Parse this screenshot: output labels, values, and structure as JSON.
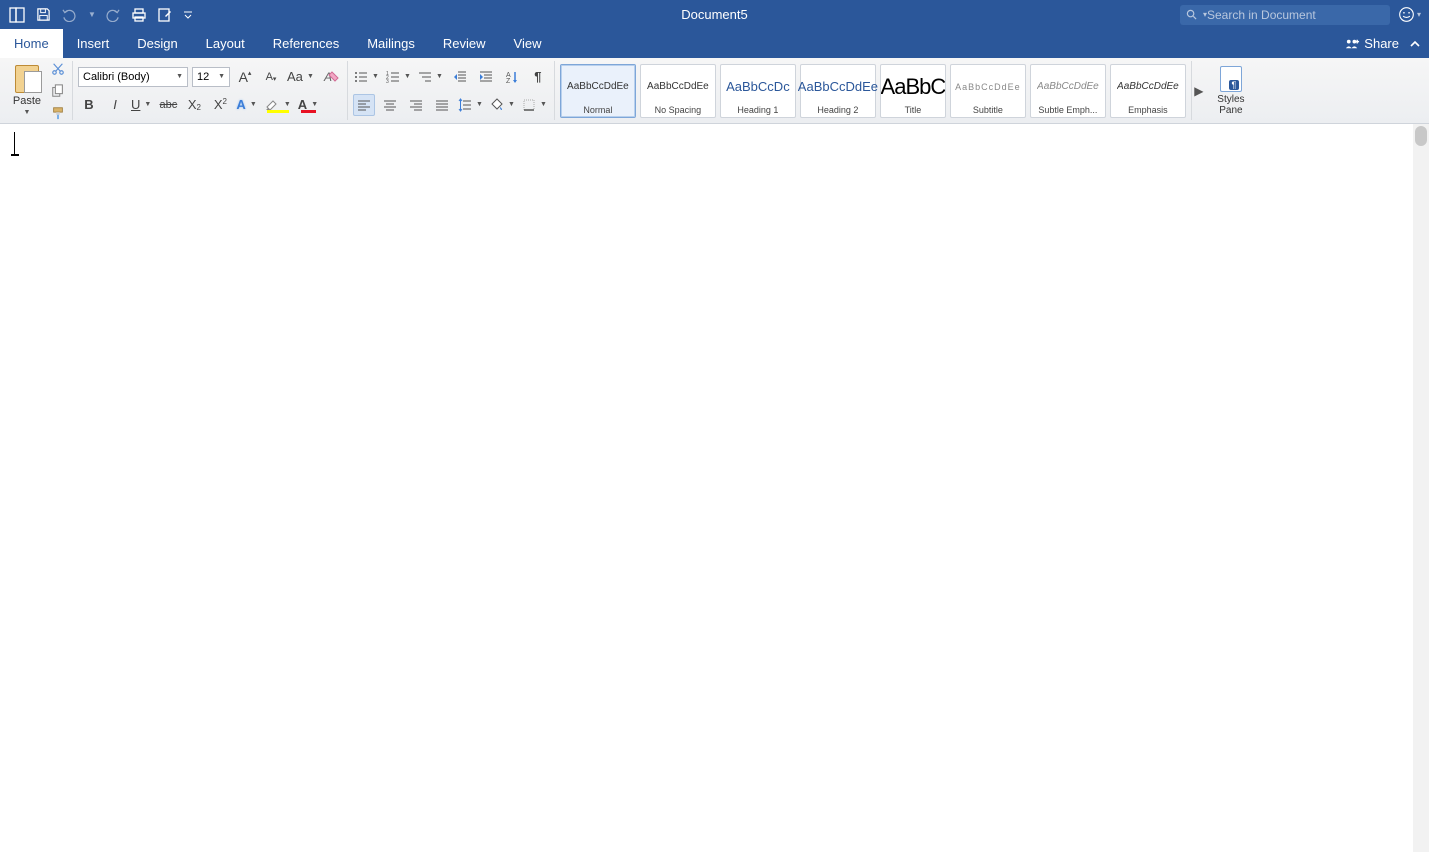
{
  "title": "Document5",
  "search": {
    "placeholder": "Search in Document"
  },
  "tabs": [
    "Home",
    "Insert",
    "Design",
    "Layout",
    "References",
    "Mailings",
    "Review",
    "View"
  ],
  "share_label": "Share",
  "clipboard": {
    "paste_label": "Paste"
  },
  "font": {
    "name": "Calibri (Body)",
    "size": "12"
  },
  "styles": [
    {
      "preview": "AaBbCcDdEe",
      "name": "Normal",
      "kind": "normal",
      "selected": true
    },
    {
      "preview": "AaBbCcDdEe",
      "name": "No Spacing",
      "kind": "normal"
    },
    {
      "preview": "AaBbCcDc",
      "name": "Heading 1",
      "kind": "heading"
    },
    {
      "preview": "AaBbCcDdEe",
      "name": "Heading 2",
      "kind": "heading"
    },
    {
      "preview": "AaBbC",
      "name": "Title",
      "kind": "title"
    },
    {
      "preview": "AaBbCcDdEe",
      "name": "Subtitle",
      "kind": "subtitle"
    },
    {
      "preview": "AaBbCcDdEe",
      "name": "Subtle Emph...",
      "kind": "subtle"
    },
    {
      "preview": "AaBbCcDdEe",
      "name": "Emphasis",
      "kind": "emphasis"
    }
  ],
  "styles_pane": {
    "label1": "Styles",
    "label2": "Pane"
  }
}
